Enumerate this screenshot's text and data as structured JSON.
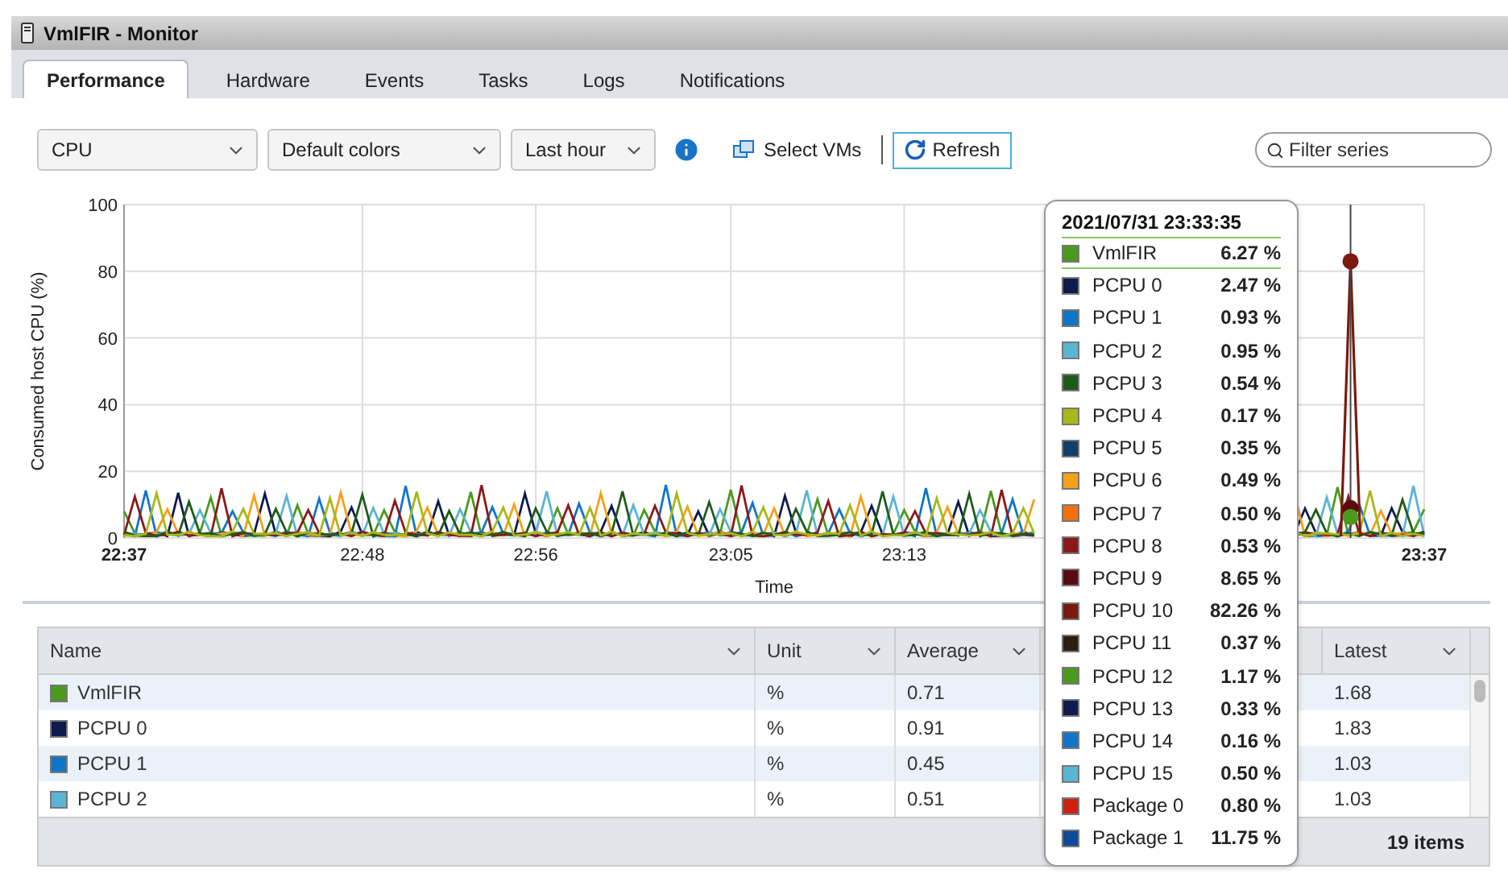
{
  "window": {
    "title": "VmlFIR - Monitor"
  },
  "tabs": [
    {
      "label": "Performance",
      "selected": true
    },
    {
      "label": "Hardware",
      "selected": false
    },
    {
      "label": "Events",
      "selected": false
    },
    {
      "label": "Tasks",
      "selected": false
    },
    {
      "label": "Logs",
      "selected": false
    },
    {
      "label": "Notifications",
      "selected": false
    }
  ],
  "toolbar": {
    "selects": [
      {
        "value": "CPU"
      },
      {
        "value": "Default colors"
      },
      {
        "value": "Last hour"
      }
    ],
    "select_vms": "Select VMs",
    "refresh": "Refresh",
    "filter": {
      "placeholder": "Filter series"
    }
  },
  "chart": {
    "y_axis_title": "Consumed host CPU (%)",
    "x_axis_title": "Time",
    "y_ticks": [
      "100",
      "80",
      "60",
      "40",
      "20",
      "0"
    ],
    "x_ticks": [
      {
        "label": "22:37",
        "bold": true
      },
      {
        "label": "22:48",
        "bold": false
      },
      {
        "label": "22:56",
        "bold": false
      },
      {
        "label": "23:05",
        "bold": false
      },
      {
        "label": "23:13",
        "bold": false
      },
      {
        "label": "23:37",
        "bold": true
      }
    ]
  },
  "tooltip": {
    "title": "2021/07/31 23:33:35",
    "entries": [
      {
        "name": "VmlFIR",
        "value": "6.27 %",
        "color": "#4a9a1e",
        "selected": true
      },
      {
        "name": "PCPU 0",
        "value": "2.47 %",
        "color": "#0d1b4d",
        "selected": false
      },
      {
        "name": "PCPU 1",
        "value": "0.93 %",
        "color": "#1175c8",
        "selected": false
      },
      {
        "name": "PCPU 2",
        "value": "0.95 %",
        "color": "#5ab4d4",
        "selected": false
      },
      {
        "name": "PCPU 3",
        "value": "0.54 %",
        "color": "#1f5a1a",
        "selected": false
      },
      {
        "name": "PCPU 4",
        "value": "0.17 %",
        "color": "#a8b81a",
        "selected": false
      },
      {
        "name": "PCPU 5",
        "value": "0.35 %",
        "color": "#0f3f6a",
        "selected": false
      },
      {
        "name": "PCPU 6",
        "value": "0.49 %",
        "color": "#f5a01a",
        "selected": false
      },
      {
        "name": "PCPU 7",
        "value": "0.50 %",
        "color": "#f07010",
        "selected": false
      },
      {
        "name": "PCPU 8",
        "value": "0.53 %",
        "color": "#8a1a1a",
        "selected": false
      },
      {
        "name": "PCPU 9",
        "value": "8.65 %",
        "color": "#5a0a10",
        "selected": false
      },
      {
        "name": "PCPU 10",
        "value": "82.26 %",
        "color": "#7a1a10",
        "selected": false
      },
      {
        "name": "PCPU 11",
        "value": "0.37 %",
        "color": "#2a2010",
        "selected": false
      },
      {
        "name": "PCPU 12",
        "value": "1.17 %",
        "color": "#4a9a1e",
        "selected": false
      },
      {
        "name": "PCPU 13",
        "value": "0.33 %",
        "color": "#0d1b4d",
        "selected": false
      },
      {
        "name": "PCPU 14",
        "value": "0.16 %",
        "color": "#1175c8",
        "selected": false
      },
      {
        "name": "PCPU 15",
        "value": "0.50 %",
        "color": "#5ab4d4",
        "selected": false
      },
      {
        "name": "Package 0",
        "value": "0.80 %",
        "color": "#d02010",
        "selected": false
      },
      {
        "name": "Package 1",
        "value": "11.75 %",
        "color": "#0d4a9a",
        "selected": false
      }
    ]
  },
  "table": {
    "columns": [
      "Name",
      "Unit",
      "Average",
      "Latest"
    ],
    "rows": [
      {
        "name": "VmlFIR",
        "color": "#4a9a1e",
        "unit": "%",
        "average": "0.71",
        "latest": "1.68"
      },
      {
        "name": "PCPU 0",
        "color": "#0d1b4d",
        "unit": "%",
        "average": "0.91",
        "latest": "1.83"
      },
      {
        "name": "PCPU 1",
        "color": "#1175c8",
        "unit": "%",
        "average": "0.45",
        "latest": "1.03"
      },
      {
        "name": "PCPU 2",
        "color": "#5ab4d4",
        "unit": "%",
        "average": "0.51",
        "latest": "1.03"
      }
    ],
    "footer": "19 items"
  }
}
